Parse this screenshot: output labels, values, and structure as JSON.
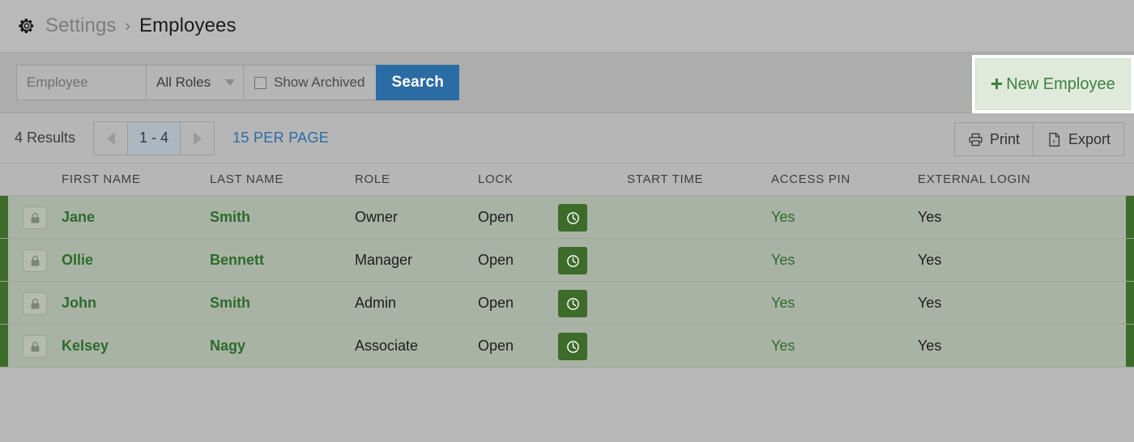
{
  "header": {
    "gear_icon": "gear-icon",
    "breadcrumb_root": "Settings",
    "breadcrumb_separator": "›",
    "breadcrumb_current": "Employees"
  },
  "search": {
    "employee_placeholder": "Employee",
    "employee_value": "",
    "role_filter_value": "All Roles",
    "show_archived_label": "Show Archived",
    "show_archived_checked": false,
    "search_button": "Search",
    "new_employee_button": "New Employee",
    "new_employee_plus": "➕"
  },
  "pagination": {
    "results_text": "4 Results",
    "prev_icon": "chevron-left-icon",
    "range_label": "1 - 4",
    "next_icon": "chevron-right-icon",
    "per_page_label": "15 PER PAGE",
    "print_label": "Print",
    "export_label": "Export"
  },
  "table": {
    "columns": [
      "FIRST NAME",
      "LAST NAME",
      "ROLE",
      "LOCK",
      "START TIME",
      "ACCESS PIN",
      "EXTERNAL LOGIN"
    ],
    "rows": [
      {
        "lock_icon": "padlock-icon",
        "first_name": "Jane",
        "last_name": "Smith",
        "role": "Owner",
        "lock": "Open",
        "start_time_icon": "clock-icon",
        "access_pin": "Yes",
        "external_login": "Yes"
      },
      {
        "lock_icon": "padlock-icon",
        "first_name": "Ollie",
        "last_name": "Bennett",
        "role": "Manager",
        "lock": "Open",
        "start_time_icon": "clock-icon",
        "access_pin": "Yes",
        "external_login": "Yes"
      },
      {
        "lock_icon": "padlock-icon",
        "first_name": "John",
        "last_name": "Smith",
        "role": "Admin",
        "lock": "Open",
        "start_time_icon": "clock-icon",
        "access_pin": "Yes",
        "external_login": "Yes"
      },
      {
        "lock_icon": "padlock-icon",
        "first_name": "Kelsey",
        "last_name": "Nagy",
        "role": "Associate",
        "lock": "Open",
        "start_time_icon": "clock-icon",
        "access_pin": "Yes",
        "external_login": "Yes"
      }
    ]
  },
  "colors": {
    "accent_green": "#3d6b2a",
    "link_green": "#2c6b2c",
    "link_blue": "#2c6ca4",
    "button_blue": "#2c6ca4",
    "new_button_bg": "#dfeada",
    "row_bg": "#a9b3a5",
    "page_bg": "#b8b8b8"
  }
}
